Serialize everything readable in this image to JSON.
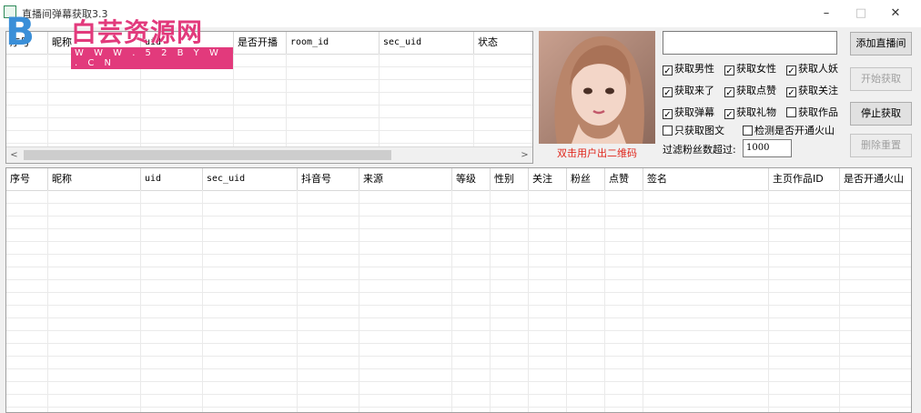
{
  "window": {
    "title": "直播间弹幕获取3.3",
    "minimize": "–",
    "maximize": "□",
    "close": "✕"
  },
  "watermark": {
    "brand": "白芸资源网",
    "url": "W W W . 5 2 B Y W . C N"
  },
  "top_table": {
    "columns": [
      "序号",
      "昵称",
      "uid",
      "是否开播",
      "room_id",
      "sec_uid",
      "状态"
    ]
  },
  "scroll": {
    "left": "<",
    "right": ">"
  },
  "photo": {
    "caption": "双击用户出二维码"
  },
  "room_input": {
    "value": ""
  },
  "buttons": {
    "add": "添加直播间",
    "start": "开始获取",
    "stop": "停止获取",
    "clear": "删除重置"
  },
  "checkboxes": [
    {
      "label": "获取男性",
      "checked": true
    },
    {
      "label": "获取女性",
      "checked": true
    },
    {
      "label": "获取人妖",
      "checked": true
    },
    {
      "label": "获取来了",
      "checked": true
    },
    {
      "label": "获取点赞",
      "checked": true
    },
    {
      "label": "获取关注",
      "checked": true
    },
    {
      "label": "获取弹幕",
      "checked": true
    },
    {
      "label": "获取礼物",
      "checked": true
    },
    {
      "label": "获取作品",
      "checked": false
    },
    {
      "label": "只获取图文",
      "checked": false
    },
    {
      "label": "检测是否开通火山",
      "checked": false
    }
  ],
  "filter": {
    "label": "过滤粉丝数超过:",
    "value": "1000"
  },
  "bottom_table": {
    "columns": [
      "序号",
      "昵称",
      "uid",
      "sec_uid",
      "抖音号",
      "来源",
      "等级",
      "性别",
      "关注",
      "粉丝",
      "点赞",
      "签名",
      "主页作品ID",
      "是否开通火山"
    ]
  },
  "colors": {
    "caption": "#e0261b",
    "watermark_brand": "#e23a7c",
    "watermark_logo": "#3a8fd8"
  },
  "icons": {
    "app": "app-icon",
    "check": "✓"
  }
}
